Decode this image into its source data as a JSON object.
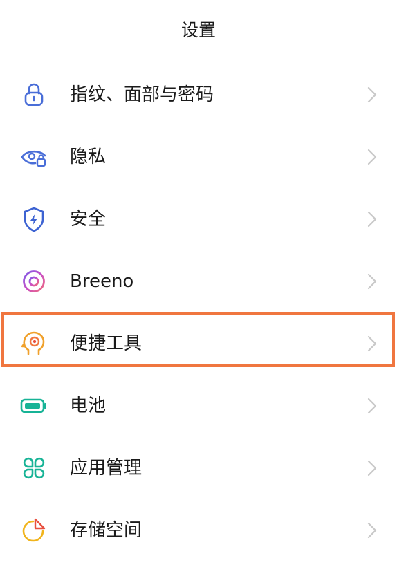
{
  "header": {
    "title": "设置"
  },
  "items": [
    {
      "label": "指纹、面部与密码",
      "icon": "lock-icon",
      "color": "#4a6ed8"
    },
    {
      "label": "隐私",
      "icon": "eye-lock-icon",
      "color": "#4a6ed8"
    },
    {
      "label": "安全",
      "icon": "shield-bolt-icon",
      "color": "#3d63d2"
    },
    {
      "label": "Breeno",
      "icon": "breeno-ring-icon",
      "color": "#c94fc5"
    },
    {
      "label": "便捷工具",
      "icon": "head-target-icon",
      "color": "#f0a12c"
    },
    {
      "label": "电池",
      "icon": "battery-icon",
      "color": "#17b396"
    },
    {
      "label": "应用管理",
      "icon": "app-grid-icon",
      "color": "#17b396"
    },
    {
      "label": "存储空间",
      "icon": "storage-pie-icon",
      "color": "#f1b41c"
    }
  ],
  "highlight": {
    "item": "便捷工具",
    "color": "#f0763f"
  }
}
